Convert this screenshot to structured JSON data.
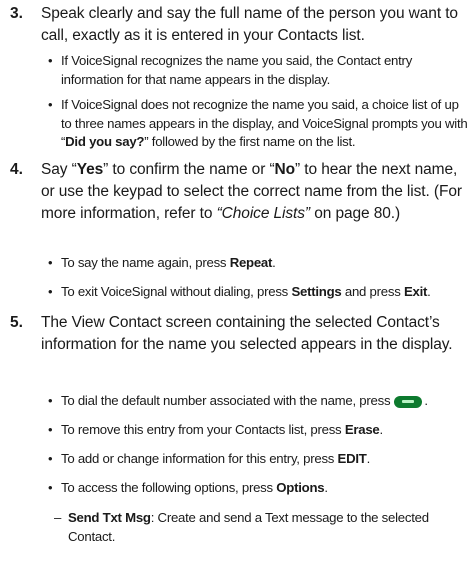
{
  "steps": [
    {
      "num": "3.",
      "text": "Speak clearly and say the full name of the person you want to call, exactly as it is entered in your Contacts list.",
      "bullets": [
        {
          "text": "If VoiceSignal recognizes the name you said, the Contact entry information for that name appears in the display."
        },
        {
          "pre": "If VoiceSignal does not recognize the name you said, a choice list of up to three names appears in the display, and VoiceSignal prompts you with “",
          "bold": "Did you say?",
          "post": "” followed by the first name on the list."
        }
      ]
    },
    {
      "num": "4.",
      "pre": "Say “",
      "yes": "Yes",
      "mid": "” to confirm the name or “",
      "no": "No",
      "post": "” to hear the next name, or use the keypad to select the correct name from the list. (For more information, refer to ",
      "ref": "“Choice Lists”",
      "post2": " on page 80.)",
      "bullets": [
        {
          "pre": "To say the name again, press ",
          "bold": "Repeat",
          "post": "."
        },
        {
          "pre": "To exit VoiceSignal without dialing, press ",
          "bold": "Settings",
          "mid": " and press ",
          "bold2": "Exit",
          "post": "."
        }
      ]
    },
    {
      "num": "5.",
      "text": "The View Contact screen containing the selected Contact’s information for the name you selected appears in the display.",
      "bullets": [
        {
          "pre": "To dial the default number associated with the name, press",
          "icon": "send-key-icon",
          "post": "."
        },
        {
          "pre": "To remove this entry from your Contacts list, press ",
          "bold": "Erase",
          "post": "."
        },
        {
          "pre": "To add or change information for this entry, press ",
          "bold": "EDIT",
          "post": "."
        },
        {
          "pre": "To access the following options, press ",
          "bold": "Options",
          "post": "."
        }
      ],
      "subitems": [
        {
          "bold": "Send Txt Msg",
          "post": ": Create and send a Text message to the selected Contact."
        }
      ]
    }
  ],
  "glyphs": {
    "bullet": "•",
    "dash": "–"
  }
}
